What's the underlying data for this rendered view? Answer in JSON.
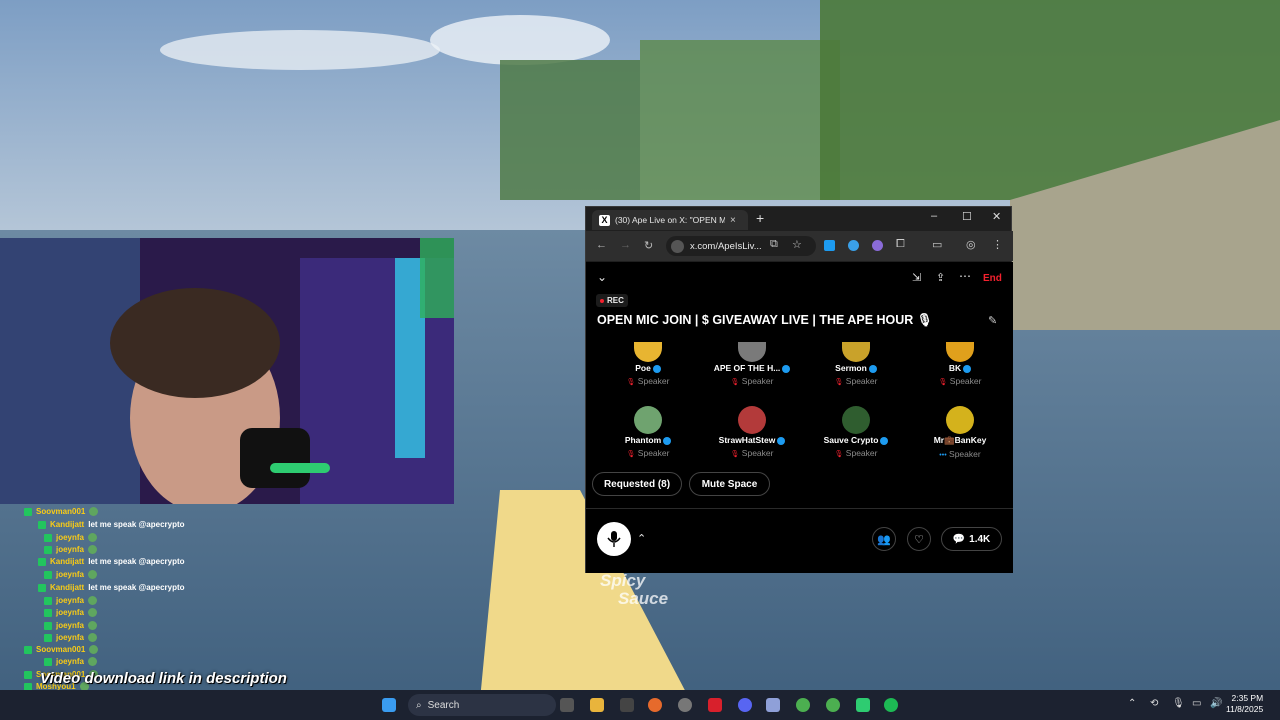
{
  "browser": {
    "tab_title": "(30) Ape Live on X: \"OPEN M",
    "url": "x.com/ApeIsLiv...",
    "new_tab": "+"
  },
  "space": {
    "end_label": "End",
    "rec_label": "REC",
    "title": "OPEN MIC JOIN | $ GIVEAWAY LIVE | THE APE HOUR",
    "speakers": [
      {
        "name": "Poe",
        "role": "Speaker",
        "color": "#e8b531"
      },
      {
        "name": "APE OF THE H...",
        "role": "Speaker",
        "color": "#7a7a7a"
      },
      {
        "name": "Sermon",
        "role": "Speaker",
        "color": "#c9a22a"
      },
      {
        "name": "BK",
        "role": "Speaker",
        "color": "#e0a01c"
      },
      {
        "name": "Phantom",
        "role": "Speaker",
        "color": "#6fa36f"
      },
      {
        "name": "StrawHatStew",
        "role": "Speaker",
        "color": "#b33a3a"
      },
      {
        "name": "Sauve Crypto",
        "role": "Speaker",
        "color": "#2f5d2f"
      },
      {
        "name": "Mr💼BanKey",
        "role": "Speaker",
        "color": "#d4b21c"
      }
    ],
    "requested_label": "Requested (8)",
    "mute_label": "Mute Space",
    "listener_count": "1.4K"
  },
  "chat": [
    {
      "name": "Soovman001",
      "msg": "",
      "indent": 0
    },
    {
      "name": "Kandijatt",
      "msg": "let me speak @apecrypto",
      "indent": 1
    },
    {
      "name": "joeynfa",
      "msg": "",
      "indent": 2
    },
    {
      "name": "joeynfa",
      "msg": "",
      "indent": 2
    },
    {
      "name": "Kandijatt",
      "msg": "let me speak @apecrypto",
      "indent": 1
    },
    {
      "name": "joeynfa",
      "msg": "",
      "indent": 2
    },
    {
      "name": "Kandijatt",
      "msg": "let me speak @apecrypto",
      "indent": 1
    },
    {
      "name": "joeynfa",
      "msg": "",
      "indent": 2
    },
    {
      "name": "joeynfa",
      "msg": "",
      "indent": 2
    },
    {
      "name": "joeynfa",
      "msg": "",
      "indent": 2
    },
    {
      "name": "joeynfa",
      "msg": "",
      "indent": 2
    },
    {
      "name": "Soovman001",
      "msg": "",
      "indent": 0
    },
    {
      "name": "joeynfa",
      "msg": "",
      "indent": 2
    },
    {
      "name": "Soovman001",
      "msg": "",
      "indent": 0
    },
    {
      "name": "Moshyou1",
      "msg": "",
      "indent": 0
    }
  ],
  "caption": "Video download link in description",
  "watermark": [
    "Spicy",
    "Sauce"
  ],
  "taskbar": {
    "search_label": "Search",
    "time": "2:35 PM",
    "date": "11/8/2025"
  }
}
